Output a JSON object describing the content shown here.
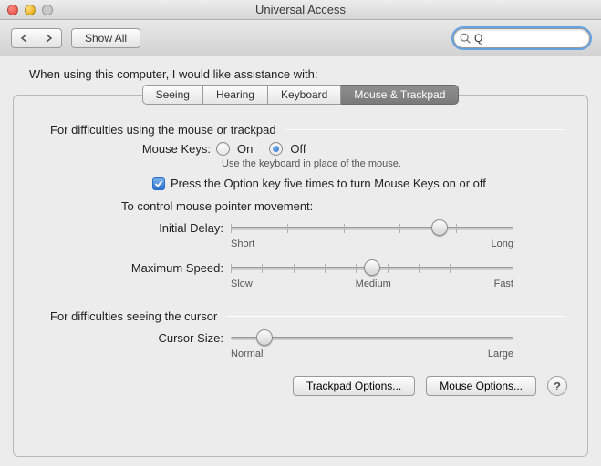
{
  "window": {
    "title": "Universal Access"
  },
  "toolbar": {
    "back": "◀",
    "forward": "▶",
    "show_all": "Show All",
    "search_value": "Q"
  },
  "intro": "When using this computer, I would like assistance with:",
  "tabs": {
    "seeing": "Seeing",
    "hearing": "Hearing",
    "keyboard": "Keyboard",
    "mouse": "Mouse & Trackpad"
  },
  "mouse_section": {
    "difficulties_using": "For difficulties using the mouse or trackpad",
    "mouse_keys_label": "Mouse Keys:",
    "on": "On",
    "off": "Off",
    "mouse_keys_value": "Off",
    "hint": "Use the keyboard in place of the mouse.",
    "checkbox_label": "Press the Option key five times to turn Mouse Keys on or off",
    "checkbox_checked": true,
    "control_movement": "To control mouse pointer movement:",
    "initial_delay_label": "Initial Delay:",
    "initial_delay_min": "Short",
    "initial_delay_max": "Long",
    "initial_delay_pct": 74,
    "max_speed_label": "Maximum Speed:",
    "max_speed_min": "Slow",
    "max_speed_mid": "Medium",
    "max_speed_max": "Fast",
    "max_speed_pct": 50,
    "difficulties_seeing": "For difficulties seeing the cursor",
    "cursor_size_label": "Cursor Size:",
    "cursor_size_min": "Normal",
    "cursor_size_max": "Large",
    "cursor_size_pct": 12
  },
  "buttons": {
    "trackpad": "Trackpad Options...",
    "mouse": "Mouse Options...",
    "help": "?"
  }
}
